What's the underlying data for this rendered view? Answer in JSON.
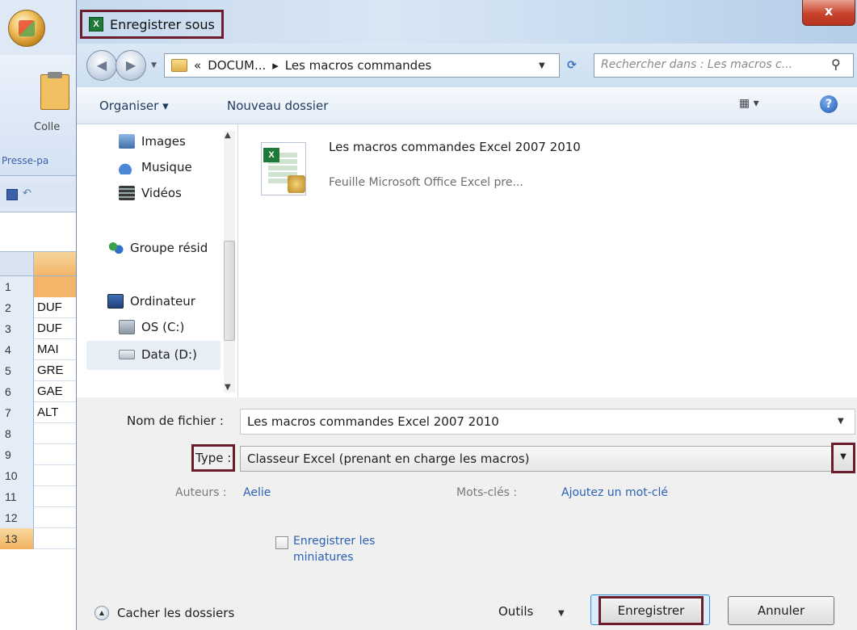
{
  "excel": {
    "paste_label": "Colle",
    "clipboard_group": "Presse-pa",
    "rows": [
      {
        "num": "1",
        "value": ""
      },
      {
        "num": "2",
        "value": "DUF"
      },
      {
        "num": "3",
        "value": "DUF"
      },
      {
        "num": "4",
        "value": "MAI"
      },
      {
        "num": "5",
        "value": "GRE"
      },
      {
        "num": "6",
        "value": "GAE"
      },
      {
        "num": "7",
        "value": "ALT"
      },
      {
        "num": "8",
        "value": ""
      },
      {
        "num": "9",
        "value": ""
      },
      {
        "num": "10",
        "value": ""
      },
      {
        "num": "11",
        "value": ""
      },
      {
        "num": "12",
        "value": ""
      },
      {
        "num": "13",
        "value": ""
      }
    ]
  },
  "dialog": {
    "title": "Enregistrer sous",
    "close_label": "x",
    "breadcrumb": {
      "prefix": "«",
      "part1": "DOCUM...",
      "separator": "▸",
      "part2": "Les macros commandes"
    },
    "search_placeholder": "Rechercher dans : Les macros c...",
    "toolbar": {
      "organise": "Organiser ▾",
      "new_folder": "Nouveau dossier",
      "view": "▦ ▾",
      "help": "?"
    },
    "nav": {
      "images": "Images",
      "music": "Musique",
      "videos": "Vidéos",
      "homegroup": "Groupe résid",
      "computer": "Ordinateur",
      "os_drive": "OS (C:)",
      "data_drive": "Data (D:)"
    },
    "file": {
      "name": "Les  macros commandes Excel 2007 2010",
      "type": "Feuille Microsoft Office Excel pre..."
    },
    "form": {
      "filename_label": "Nom de fichier :",
      "filename_value": "Les  macros commandes Excel 2007 2010",
      "type_label": "Type :",
      "type_value": "Classeur Excel (prenant en charge les macros)",
      "authors_label": "Auteurs :",
      "authors_value": "Aelie",
      "tags_label": "Mots-clés :",
      "tags_value": "Ajoutez un mot-clé",
      "thumbnails_label": "Enregistrer les miniatures",
      "hide_folders": "Cacher les dossiers",
      "tools": "Outils",
      "save": "Enregistrer",
      "cancel": "Annuler"
    }
  },
  "colors": {
    "highlight_frame": "#6b1d2b",
    "link_blue": "#2a62b4",
    "excel_green": "#1f7a3a",
    "selected_row_orange": "#f4b56a"
  }
}
